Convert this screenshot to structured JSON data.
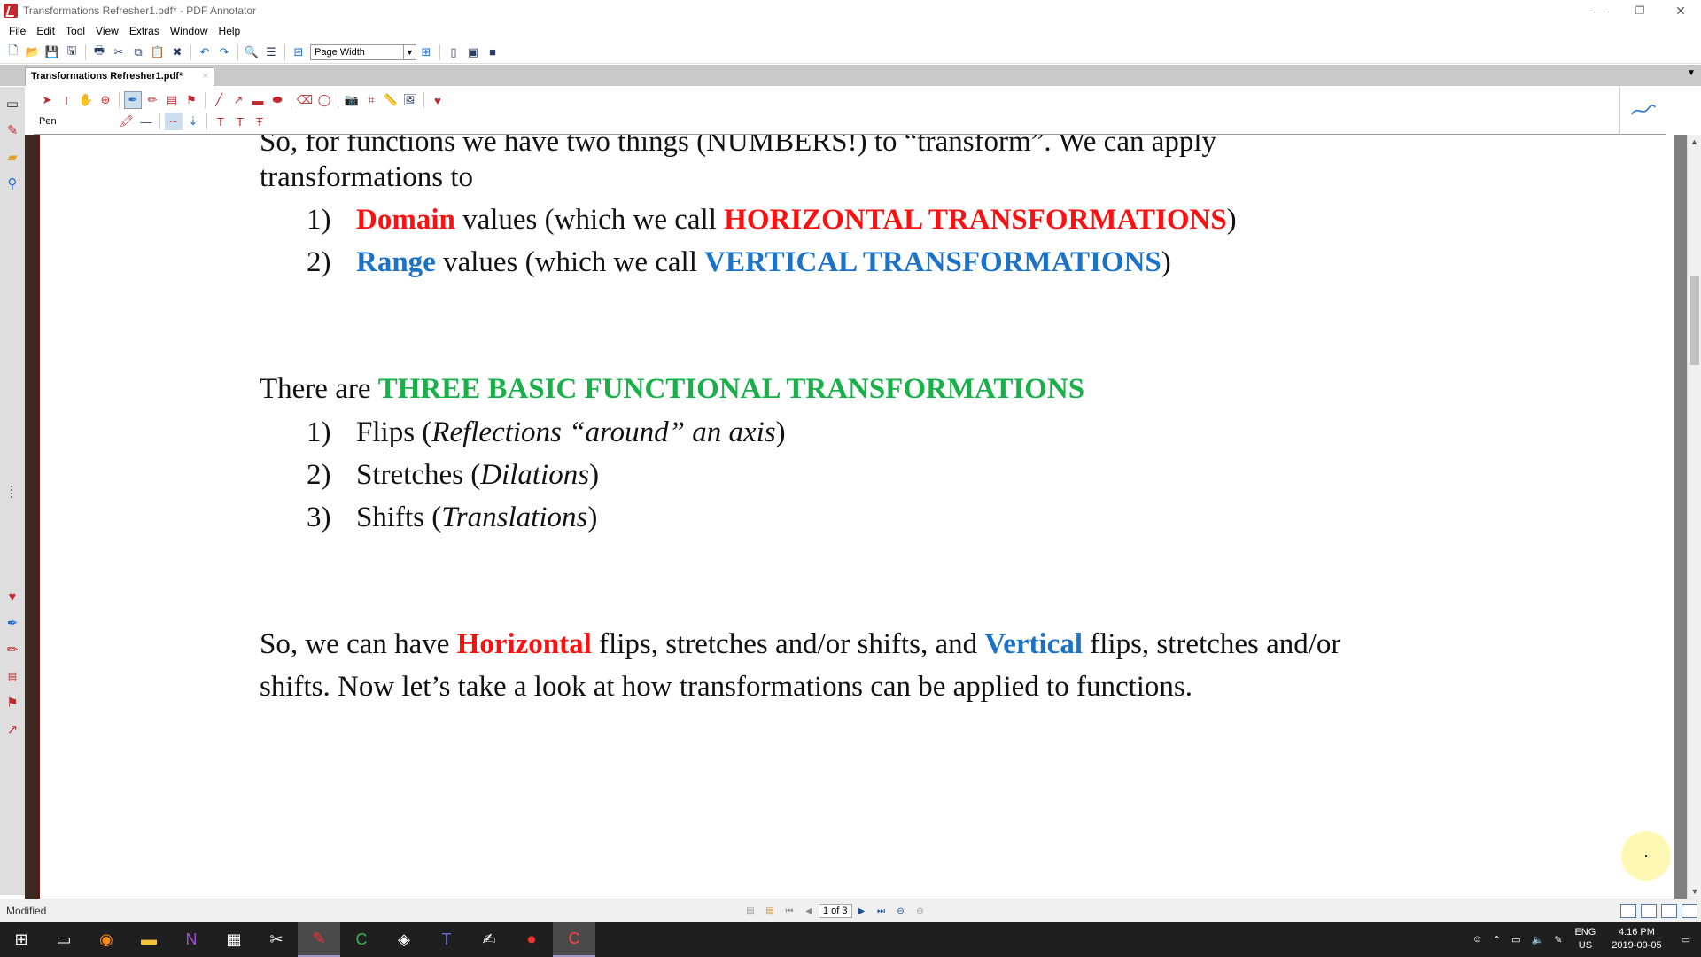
{
  "window": {
    "title": "Transformations Refresher1.pdf* - PDF Annotator",
    "minimize": "—",
    "restore": "❐",
    "close": "✕"
  },
  "menu": [
    "File",
    "Edit",
    "Tool",
    "View",
    "Extras",
    "Window",
    "Help"
  ],
  "toolbar": {
    "zoom_mode": "Page Width"
  },
  "tab": {
    "label": "Transformations Refresher1.pdf*",
    "close": "×"
  },
  "annot": {
    "tool_name": "Pen"
  },
  "document": {
    "line1": "So, for functions we have two things (NUMBERS!) to “transform”. We can apply",
    "line2": "transformations to",
    "item1_num": "1)",
    "item1_a": "Domain",
    "item1_b": " values (which we call ",
    "item1_c": "HORIZONTAL TRANSFORMATIONS",
    "item1_d": ")",
    "item2_num": "2)",
    "item2_a": "Range",
    "item2_b": " values (which we call ",
    "item2_c": "VERTICAL TRANSFORMATIONS",
    "item2_d": ")",
    "three_a": "There are ",
    "three_b": "THREE BASIC FUNCTIONAL TRANSFORMATIONS",
    "t1_num": "1)",
    "t1_a": "Flips (",
    "t1_b": "Reflections “around” an axis",
    "t1_c": ")",
    "t2_num": "2)",
    "t2_a": "Stretches (",
    "t2_b": "Dilations",
    "t2_c": ")",
    "t3_num": "3)",
    "t3_a": "Shifts (",
    "t3_b": "Translations",
    "t3_c": ")",
    "so_a": "So, we can have ",
    "so_b": "Horizontal",
    "so_c": " flips, stretches and/or shifts, and ",
    "so_d": "Vertical",
    "so_e": " flips, stretches and/or",
    "last": "shifts. Now let’s take a look at how transformations can be applied to functions."
  },
  "status": {
    "text": "Modified",
    "page_indicator": "1 of 3"
  },
  "taskbar": {
    "lang_line1": "ENG",
    "lang_line2": "US",
    "time": "4:16 PM",
    "date": "2019-09-05"
  }
}
